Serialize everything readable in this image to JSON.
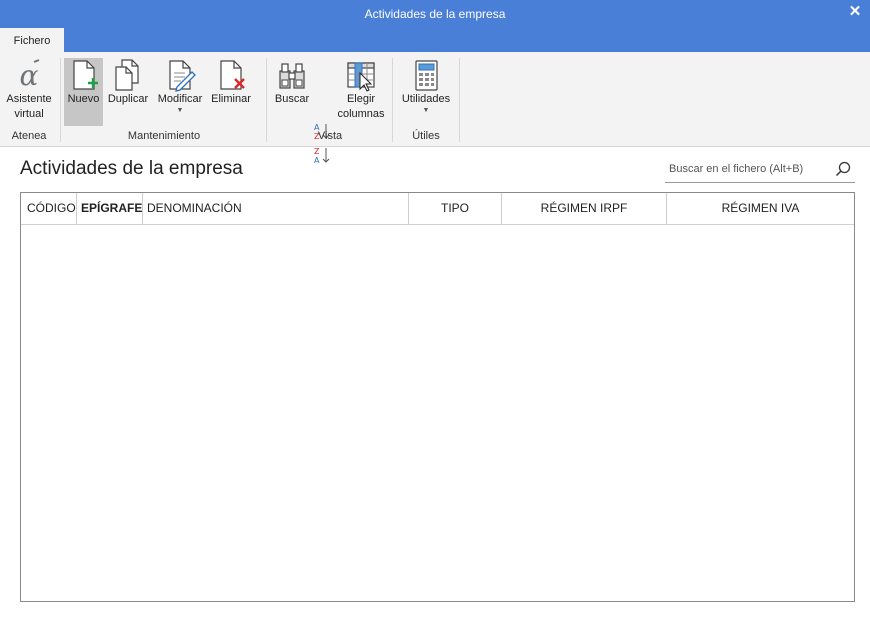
{
  "window": {
    "title": "Actividades de la empresa",
    "close_glyph": "✕"
  },
  "tabs": [
    {
      "label": "Fichero"
    }
  ],
  "ribbon": {
    "groups": {
      "atenea": {
        "label": "Atenea"
      },
      "mantenimiento": {
        "label": "Mantenimiento"
      },
      "vista": {
        "label": "Vista"
      },
      "utiles": {
        "label": "Útiles"
      }
    },
    "asistente": {
      "line1": "Asistente",
      "line2": "virtual",
      "icon": "alpha-icon"
    },
    "nuevo": {
      "label": "Nuevo",
      "icon": "new-document-icon"
    },
    "duplicar": {
      "label": "Duplicar",
      "icon": "duplicate-icon"
    },
    "modificar": {
      "label": "Modificar",
      "icon": "edit-document-icon",
      "arrow": "▼"
    },
    "eliminar": {
      "label": "Eliminar",
      "icon": "delete-document-icon"
    },
    "buscar": {
      "label": "Buscar",
      "icon": "binoculars-icon"
    },
    "sort_asc": {
      "top": "A",
      "bottom": "Z",
      "icon": "sort-ascending-icon"
    },
    "sort_desc": {
      "top": "Z",
      "bottom": "A",
      "icon": "sort-descending-icon"
    },
    "elegir": {
      "line1": "Elegir",
      "line2": "columnas",
      "icon": "choose-columns-icon"
    },
    "utilidades": {
      "label": "Utilidades",
      "icon": "calculator-icon",
      "arrow": "▼"
    }
  },
  "main": {
    "title": "Actividades de la empresa",
    "search": {
      "placeholder": "Buscar en el fichero (Alt+B)",
      "value": ""
    }
  },
  "table": {
    "columns": [
      "CÓDIGO",
      "EPÍGRAFE",
      "DENOMINACIÓN",
      "TIPO",
      "RÉGIMEN IRPF",
      "RÉGIMEN IVA"
    ],
    "sorted_column": "EPÍGRAFE",
    "rows": []
  },
  "colors": {
    "titlebar": "#4a7fd8",
    "ribbon_bg": "#f3f3f3",
    "active_button": "#c6c6c6",
    "accent_green": "#21a047",
    "accent_red": "#d9262a"
  }
}
